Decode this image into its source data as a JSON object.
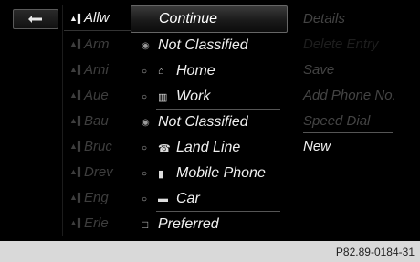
{
  "back_button": {
    "icon": "back-arrow-icon"
  },
  "contacts": [
    {
      "name": "Allw",
      "active": true
    },
    {
      "name": "Arm",
      "active": false
    },
    {
      "name": "Arni",
      "active": false
    },
    {
      "name": "Aue",
      "active": false
    },
    {
      "name": "Bau",
      "active": false
    },
    {
      "name": "Bruc",
      "active": false
    },
    {
      "name": "Drev",
      "active": false
    },
    {
      "name": "Eng",
      "active": false
    },
    {
      "name": "Erle",
      "active": false
    }
  ],
  "menu": {
    "continue_label": "Continue",
    "not_classified_1": "Not Classified",
    "home": "Home",
    "work": "Work",
    "not_classified_2": "Not Classified",
    "land_line": "Land Line",
    "mobile_phone": "Mobile Phone",
    "car": "Car",
    "preferred": "Preferred"
  },
  "right_menu": {
    "details": "Details",
    "delete_entry": "Delete Entry",
    "save": "Save",
    "add_phone": "Add Phone No.",
    "speed_dial": "Speed Dial",
    "new": "New"
  },
  "footer_code": "P82.89-0184-31"
}
